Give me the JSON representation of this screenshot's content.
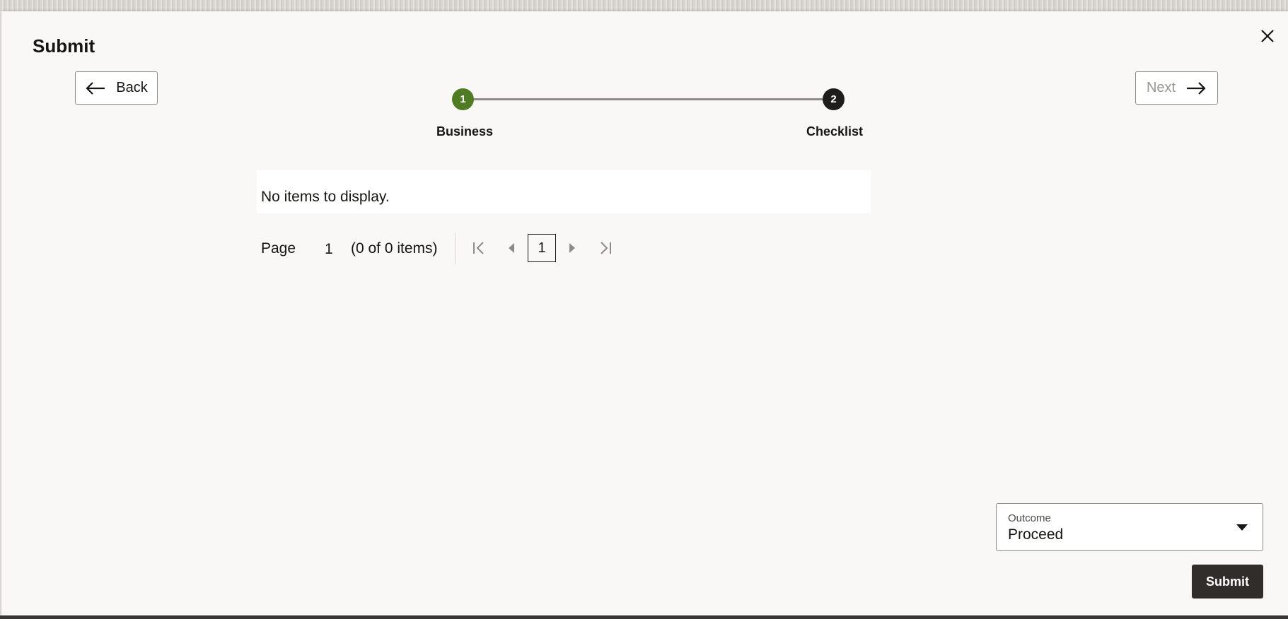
{
  "dialog": {
    "title": "Submit"
  },
  "nav": {
    "back_label": "Back",
    "next_label": "Next"
  },
  "stepper": {
    "steps": [
      {
        "number": "1",
        "label": "Business",
        "status": "completed",
        "color": "#4f7b24"
      },
      {
        "number": "2",
        "label": "Checklist",
        "status": "current",
        "color": "#1e1d1b"
      }
    ]
  },
  "table": {
    "empty_message": "No items to display."
  },
  "pagination": {
    "page_label": "Page",
    "page_value": "1",
    "items_summary": "(0 of 0 items)",
    "current_page_button": "1"
  },
  "outcome": {
    "label": "Outcome",
    "value": "Proceed"
  },
  "actions": {
    "submit_label": "Submit"
  },
  "icons": [
    "close-icon",
    "arrow-left-icon",
    "arrow-right-icon",
    "first-page-icon",
    "previous-page-icon",
    "next-page-icon",
    "last-page-icon",
    "dropdown-caret-icon"
  ],
  "colors": {
    "accent_complete": "#4f7b24",
    "primary_button": "#312d2a",
    "background": "#f9f8f6"
  }
}
